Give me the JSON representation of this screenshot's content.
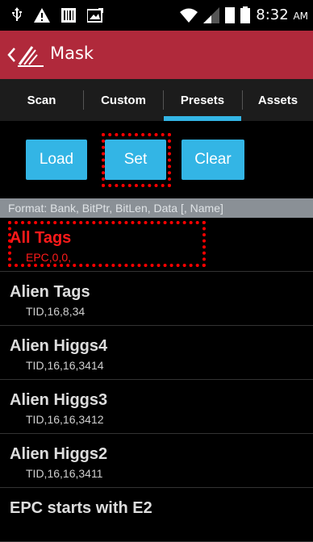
{
  "status_bar": {
    "time": "8:32",
    "ampm": "AM"
  },
  "action_bar": {
    "title": "Mask"
  },
  "tabs": [
    {
      "label": "Scan"
    },
    {
      "label": "Custom"
    },
    {
      "label": "Presets",
      "selected": true
    },
    {
      "label": "Assets"
    }
  ],
  "buttons": {
    "load": "Load",
    "set": "Set",
    "clear": "Clear"
  },
  "format_hint": "Format: Bank, BitPtr, BitLen, Data [, Name]",
  "presets": [
    {
      "name": "All Tags",
      "data": "EPC,0,0,",
      "selected": true
    },
    {
      "name": "Alien Tags",
      "data": "TID,16,8,34"
    },
    {
      "name": "Alien Higgs4",
      "data": "TID,16,16,3414"
    },
    {
      "name": "Alien Higgs3",
      "data": "TID,16,16,3412"
    },
    {
      "name": "Alien Higgs2",
      "data": "TID,16,16,3411"
    },
    {
      "name": "EPC starts with E2",
      "data": ""
    }
  ],
  "colors": {
    "action_bar": "#b0293b",
    "accent": "#33b5e5",
    "highlight": "#ff0000"
  }
}
